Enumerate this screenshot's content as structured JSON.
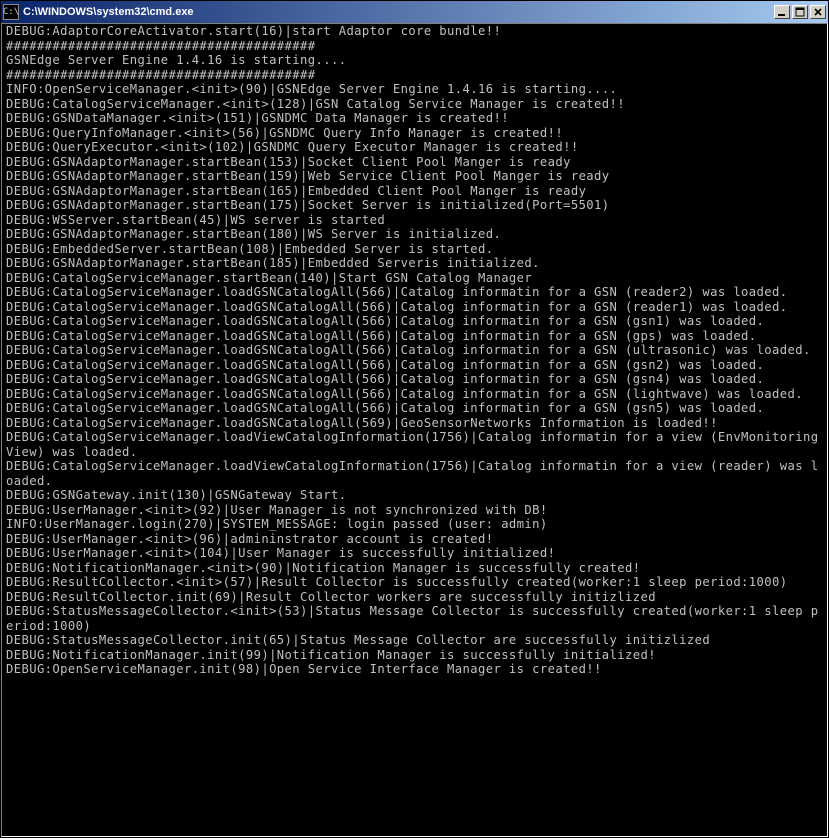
{
  "window": {
    "title": "C:\\WINDOWS\\system32\\cmd.exe",
    "icon_label": "cmd"
  },
  "console_lines": [
    "DEBUG:AdaptorCoreActivator.start(16)|start Adaptor core bundle!!",
    "########################################",
    "GSNEdge Server Engine 1.4.16 is starting....",
    "########################################",
    "INFO:OpenServiceManager.<init>(90)|GSNEdge Server Engine 1.4.16 is starting....",
    "DEBUG:CatalogServiceManager.<init>(128)|GSN Catalog Service Manager is created!!",
    "DEBUG:GSNDataManager.<init>(151)|GSNDMC Data Manager is created!!",
    "DEBUG:QueryInfoManager.<init>(56)|GSNDMC Query Info Manager is created!!",
    "DEBUG:QueryExecutor.<init>(102)|GSNDMC Query Executor Manager is created!!",
    "DEBUG:GSNAdaptorManager.startBean(153)|Socket Client Pool Manger is ready",
    "DEBUG:GSNAdaptorManager.startBean(159)|Web Service Client Pool Manger is ready",
    "DEBUG:GSNAdaptorManager.startBean(165)|Embedded Client Pool Manger is ready",
    "DEBUG:GSNAdaptorManager.startBean(175)|Socket Server is initialized(Port=5501)",
    "DEBUG:WSServer.startBean(45)|WS server is started",
    "DEBUG:GSNAdaptorManager.startBean(180)|WS Server is initialized.",
    "DEBUG:EmbeddedServer.startBean(108)|Embedded Server is started.",
    "DEBUG:GSNAdaptorManager.startBean(185)|Embedded Serveris initialized.",
    "DEBUG:CatalogServiceManager.startBean(140)|Start GSN Catalog Manager",
    "DEBUG:CatalogServiceManager.loadGSNCatalogAll(566)|Catalog informatin for a GSN (reader2) was loaded.",
    "DEBUG:CatalogServiceManager.loadGSNCatalogAll(566)|Catalog informatin for a GSN (reader1) was loaded.",
    "DEBUG:CatalogServiceManager.loadGSNCatalogAll(566)|Catalog informatin for a GSN (gsn1) was loaded.",
    "DEBUG:CatalogServiceManager.loadGSNCatalogAll(566)|Catalog informatin for a GSN (gps) was loaded.",
    "DEBUG:CatalogServiceManager.loadGSNCatalogAll(566)|Catalog informatin for a GSN (ultrasonic) was loaded.",
    "DEBUG:CatalogServiceManager.loadGSNCatalogAll(566)|Catalog informatin for a GSN (gsn2) was loaded.",
    "DEBUG:CatalogServiceManager.loadGSNCatalogAll(566)|Catalog informatin for a GSN (gsn4) was loaded.",
    "DEBUG:CatalogServiceManager.loadGSNCatalogAll(566)|Catalog informatin for a GSN (lightwave) was loaded.",
    "DEBUG:CatalogServiceManager.loadGSNCatalogAll(566)|Catalog informatin for a GSN (gsn5) was loaded.",
    "DEBUG:CatalogServiceManager.loadGSNCatalogAll(569)|GeoSensorNetworks Information is loaded!!",
    "DEBUG:CatalogServiceManager.loadViewCatalogInformation(1756)|Catalog informatin for a view (EnvMonitoringView) was loaded.",
    "DEBUG:CatalogServiceManager.loadViewCatalogInformation(1756)|Catalog informatin for a view (reader) was loaded.",
    "DEBUG:GSNGateway.init(130)|GSNGateway Start.",
    "DEBUG:UserManager.<init>(92)|User Manager is not synchronized with DB!",
    "INFO:UserManager.login(270)|SYSTEM_MESSAGE: login passed (user: admin)",
    "DEBUG:UserManager.<init>(96)|admininstrator account is created!",
    "DEBUG:UserManager.<init>(104)|User Manager is successfully initialized!",
    "DEBUG:NotificationManager.<init>(90)|Notification Manager is successfully created!",
    "DEBUG:ResultCollector.<init>(57)|Result Collector is successfully created(worker:1 sleep period:1000)",
    "DEBUG:ResultCollector.init(69)|Result Collector workers are successfully initizlized",
    "DEBUG:StatusMessageCollector.<init>(53)|Status Message Collector is successfully created(worker:1 sleep period:1000)",
    "DEBUG:StatusMessageCollector.init(65)|Status Message Collector are successfully initizlized",
    "DEBUG:NotificationManager.init(99)|Notification Manager is successfully initialized!",
    "DEBUG:OpenServiceManager.init(98)|Open Service Interface Manager is created!!"
  ]
}
